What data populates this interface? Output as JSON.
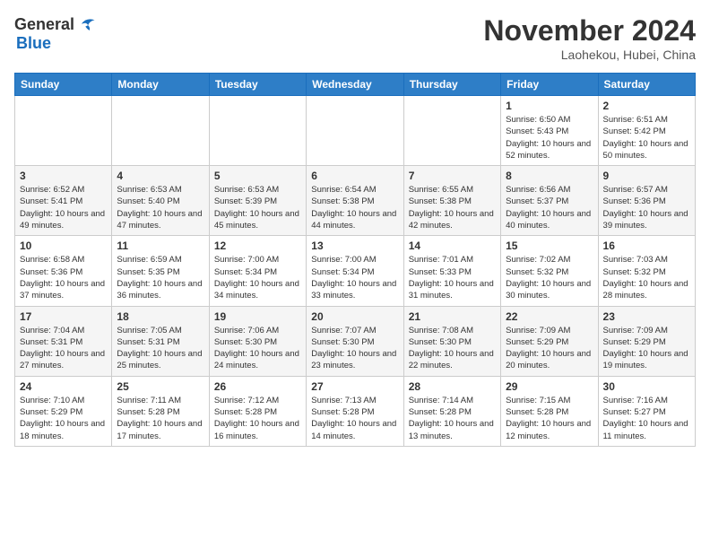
{
  "header": {
    "logo_general": "General",
    "logo_blue": "Blue",
    "month_title": "November 2024",
    "location": "Laohekou, Hubei, China"
  },
  "days_of_week": [
    "Sunday",
    "Monday",
    "Tuesday",
    "Wednesday",
    "Thursday",
    "Friday",
    "Saturday"
  ],
  "weeks": [
    [
      {
        "day": "",
        "info": ""
      },
      {
        "day": "",
        "info": ""
      },
      {
        "day": "",
        "info": ""
      },
      {
        "day": "",
        "info": ""
      },
      {
        "day": "",
        "info": ""
      },
      {
        "day": "1",
        "info": "Sunrise: 6:50 AM\nSunset: 5:43 PM\nDaylight: 10 hours and 52 minutes."
      },
      {
        "day": "2",
        "info": "Sunrise: 6:51 AM\nSunset: 5:42 PM\nDaylight: 10 hours and 50 minutes."
      }
    ],
    [
      {
        "day": "3",
        "info": "Sunrise: 6:52 AM\nSunset: 5:41 PM\nDaylight: 10 hours and 49 minutes."
      },
      {
        "day": "4",
        "info": "Sunrise: 6:53 AM\nSunset: 5:40 PM\nDaylight: 10 hours and 47 minutes."
      },
      {
        "day": "5",
        "info": "Sunrise: 6:53 AM\nSunset: 5:39 PM\nDaylight: 10 hours and 45 minutes."
      },
      {
        "day": "6",
        "info": "Sunrise: 6:54 AM\nSunset: 5:38 PM\nDaylight: 10 hours and 44 minutes."
      },
      {
        "day": "7",
        "info": "Sunrise: 6:55 AM\nSunset: 5:38 PM\nDaylight: 10 hours and 42 minutes."
      },
      {
        "day": "8",
        "info": "Sunrise: 6:56 AM\nSunset: 5:37 PM\nDaylight: 10 hours and 40 minutes."
      },
      {
        "day": "9",
        "info": "Sunrise: 6:57 AM\nSunset: 5:36 PM\nDaylight: 10 hours and 39 minutes."
      }
    ],
    [
      {
        "day": "10",
        "info": "Sunrise: 6:58 AM\nSunset: 5:36 PM\nDaylight: 10 hours and 37 minutes."
      },
      {
        "day": "11",
        "info": "Sunrise: 6:59 AM\nSunset: 5:35 PM\nDaylight: 10 hours and 36 minutes."
      },
      {
        "day": "12",
        "info": "Sunrise: 7:00 AM\nSunset: 5:34 PM\nDaylight: 10 hours and 34 minutes."
      },
      {
        "day": "13",
        "info": "Sunrise: 7:00 AM\nSunset: 5:34 PM\nDaylight: 10 hours and 33 minutes."
      },
      {
        "day": "14",
        "info": "Sunrise: 7:01 AM\nSunset: 5:33 PM\nDaylight: 10 hours and 31 minutes."
      },
      {
        "day": "15",
        "info": "Sunrise: 7:02 AM\nSunset: 5:32 PM\nDaylight: 10 hours and 30 minutes."
      },
      {
        "day": "16",
        "info": "Sunrise: 7:03 AM\nSunset: 5:32 PM\nDaylight: 10 hours and 28 minutes."
      }
    ],
    [
      {
        "day": "17",
        "info": "Sunrise: 7:04 AM\nSunset: 5:31 PM\nDaylight: 10 hours and 27 minutes."
      },
      {
        "day": "18",
        "info": "Sunrise: 7:05 AM\nSunset: 5:31 PM\nDaylight: 10 hours and 25 minutes."
      },
      {
        "day": "19",
        "info": "Sunrise: 7:06 AM\nSunset: 5:30 PM\nDaylight: 10 hours and 24 minutes."
      },
      {
        "day": "20",
        "info": "Sunrise: 7:07 AM\nSunset: 5:30 PM\nDaylight: 10 hours and 23 minutes."
      },
      {
        "day": "21",
        "info": "Sunrise: 7:08 AM\nSunset: 5:30 PM\nDaylight: 10 hours and 22 minutes."
      },
      {
        "day": "22",
        "info": "Sunrise: 7:09 AM\nSunset: 5:29 PM\nDaylight: 10 hours and 20 minutes."
      },
      {
        "day": "23",
        "info": "Sunrise: 7:09 AM\nSunset: 5:29 PM\nDaylight: 10 hours and 19 minutes."
      }
    ],
    [
      {
        "day": "24",
        "info": "Sunrise: 7:10 AM\nSunset: 5:29 PM\nDaylight: 10 hours and 18 minutes."
      },
      {
        "day": "25",
        "info": "Sunrise: 7:11 AM\nSunset: 5:28 PM\nDaylight: 10 hours and 17 minutes."
      },
      {
        "day": "26",
        "info": "Sunrise: 7:12 AM\nSunset: 5:28 PM\nDaylight: 10 hours and 16 minutes."
      },
      {
        "day": "27",
        "info": "Sunrise: 7:13 AM\nSunset: 5:28 PM\nDaylight: 10 hours and 14 minutes."
      },
      {
        "day": "28",
        "info": "Sunrise: 7:14 AM\nSunset: 5:28 PM\nDaylight: 10 hours and 13 minutes."
      },
      {
        "day": "29",
        "info": "Sunrise: 7:15 AM\nSunset: 5:28 PM\nDaylight: 10 hours and 12 minutes."
      },
      {
        "day": "30",
        "info": "Sunrise: 7:16 AM\nSunset: 5:27 PM\nDaylight: 10 hours and 11 minutes."
      }
    ]
  ]
}
